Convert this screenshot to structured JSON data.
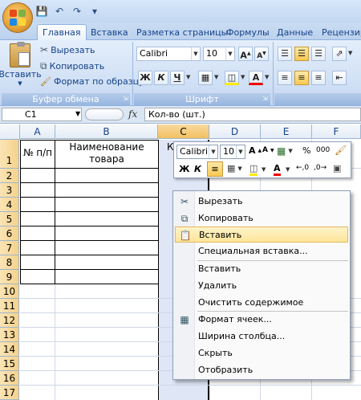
{
  "qat": {
    "icons": [
      "save-icon",
      "undo-icon",
      "redo-icon",
      "customize-icon"
    ]
  },
  "tabs": [
    "Главная",
    "Вставка",
    "Разметка страницы",
    "Формулы",
    "Данные",
    "Рецензиро"
  ],
  "ribbon": {
    "clipboard": {
      "paste_label": "Вставить",
      "cut_label": "Вырезать",
      "copy_label": "Копировать",
      "format_painter_label": "Формат по образцу",
      "group_label": "Буфер обмена"
    },
    "font": {
      "font_name": "Calibri",
      "font_size": "10",
      "bold": "Ж",
      "italic": "К",
      "underline": "Ч",
      "group_label": "Шрифт"
    }
  },
  "formula_bar": {
    "name_box": "C1",
    "fx": "fx",
    "content": "Кол-во (шт.)"
  },
  "columns": [
    "A",
    "B",
    "C",
    "D",
    "E",
    "F"
  ],
  "rows": [
    "1",
    "2",
    "3",
    "4",
    "5",
    "6",
    "7",
    "8",
    "9",
    "10",
    "11",
    "12",
    "13",
    "14",
    "15",
    "16",
    "17"
  ],
  "cells": {
    "a1": "№ п/п",
    "b1": "Наименование товара",
    "c1_partial": "К"
  },
  "mini_toolbar": {
    "font_name": "Calibri",
    "font_size": "10",
    "grow": "A",
    "shrink": "A",
    "percent": "%",
    "thousands": "000",
    "bold": "Ж",
    "italic": "К"
  },
  "context_menu": [
    {
      "label": "Вырезать",
      "icon": "scissors-icon"
    },
    {
      "label": "Копировать",
      "icon": "copy-icon"
    },
    {
      "label": "Вставить",
      "icon": "paste-icon",
      "highlighted": true
    },
    {
      "label": "Специальная вставка...",
      "icon": ""
    },
    {
      "label": "Вставить",
      "icon": ""
    },
    {
      "label": "Удалить",
      "icon": ""
    },
    {
      "label": "Очистить содержимое",
      "icon": ""
    },
    {
      "label": "Формат ячеек...",
      "icon": "format-cells-icon"
    },
    {
      "label": "Ширина столбца...",
      "icon": ""
    },
    {
      "label": "Скрыть",
      "icon": ""
    },
    {
      "label": "Отобразить",
      "icon": ""
    }
  ]
}
